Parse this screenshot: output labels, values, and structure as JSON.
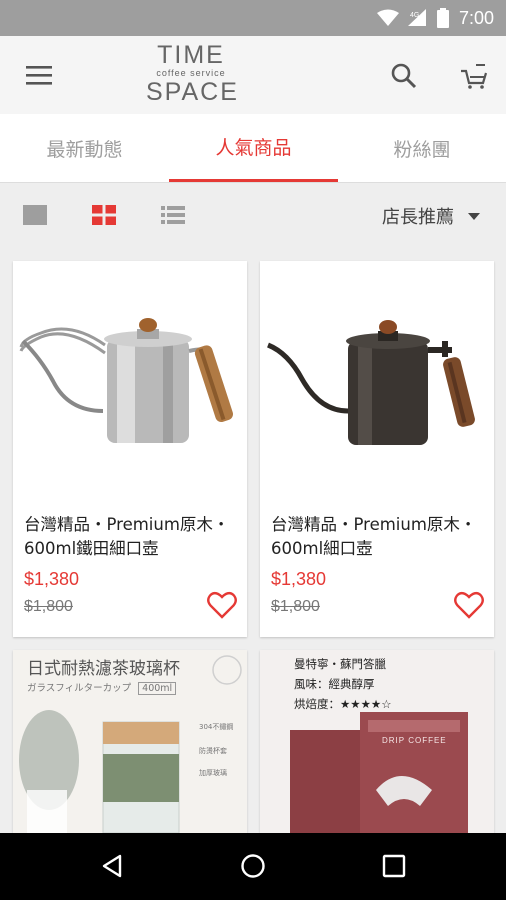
{
  "status_bar": {
    "time": "7:00",
    "network": "4G"
  },
  "app_bar": {
    "logo_line1": "TIME",
    "logo_line2": "coffee service",
    "logo_line3": "SPACE"
  },
  "tabs": [
    {
      "label": "最新動態",
      "active": false
    },
    {
      "label": "人氣商品",
      "active": true
    },
    {
      "label": "粉絲團",
      "active": false
    }
  ],
  "toolbar": {
    "views": [
      "single-view-icon",
      "grid-view-icon",
      "list-view-icon"
    ],
    "active_view": "grid-view-icon",
    "sort_label": "店長推薦"
  },
  "products": [
    {
      "title": "台灣精品・Premium原木・600ml鐵田細口壺",
      "price": "$1,380",
      "old_price": "$1,800",
      "image": "silver-kettle"
    },
    {
      "title": "台灣精品・Premium原木・600ml細口壺",
      "price": "$1,380",
      "old_price": "$1,800",
      "image": "black-kettle"
    },
    {
      "title": "",
      "image": "glass-tea-cup",
      "image_text": {
        "heading": "日式耐熱濾茶玻璃杯",
        "sub": "ガラスフィルターカップ",
        "capacity": "400ml",
        "notes": [
          "304不鏽鋼",
          "防燙杯套",
          "加厚玻璃"
        ]
      }
    },
    {
      "title": "",
      "image": "drip-coffee-box",
      "image_text": {
        "line1": "曼特寧・蘇門答臘",
        "line2": "風味：經典醇厚",
        "line3": "烘焙度：★★★★☆",
        "box_label": "DRIP COFFEE"
      }
    }
  ],
  "colors": {
    "accent": "#e53935",
    "statusbar": "#9e9e9e",
    "appbar": "#f5f5f5"
  }
}
